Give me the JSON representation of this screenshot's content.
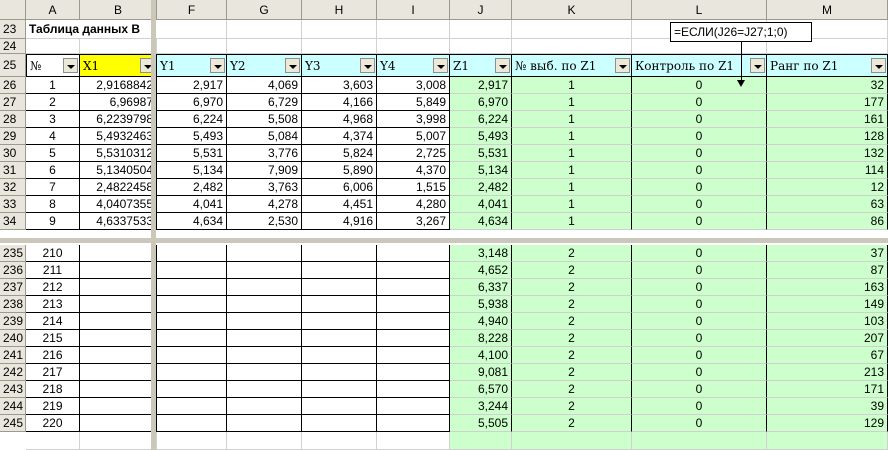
{
  "columns": [
    "A",
    "B",
    "F",
    "G",
    "H",
    "I",
    "J",
    "K",
    "L",
    "M"
  ],
  "rows_top": [
    "23",
    "24",
    "25",
    "26",
    "27",
    "28",
    "29",
    "30",
    "31",
    "32",
    "33",
    "34"
  ],
  "rows_bottom": [
    "235",
    "236",
    "237",
    "238",
    "239",
    "240",
    "241",
    "242",
    "243",
    "244",
    "245"
  ],
  "title": "Таблица данных В",
  "headers": {
    "num": "№",
    "x1": "X1",
    "y1": "Y1",
    "y2": "Y2",
    "y3": "Y3",
    "y4": "Y4",
    "z1": "Z1",
    "sample": "№ выб. по Z1",
    "control": "Контроль по Z1",
    "rank": "Ранг по Z1"
  },
  "formula_callout": "=ЕСЛИ(J26=J27;1;0)",
  "top_data": [
    [
      "1",
      "2,9168842",
      "2,917",
      "4,069",
      "3,603",
      "3,008",
      "2,917",
      "1",
      "0",
      "32"
    ],
    [
      "2",
      "6,96987",
      "6,970",
      "6,729",
      "4,166",
      "5,849",
      "6,970",
      "1",
      "0",
      "177"
    ],
    [
      "3",
      "6,2239798",
      "6,224",
      "5,508",
      "4,968",
      "3,998",
      "6,224",
      "1",
      "0",
      "161"
    ],
    [
      "4",
      "5,4932463",
      "5,493",
      "5,084",
      "4,374",
      "5,007",
      "5,493",
      "1",
      "0",
      "128"
    ],
    [
      "5",
      "5,5310312",
      "5,531",
      "3,776",
      "5,824",
      "2,725",
      "5,531",
      "1",
      "0",
      "132"
    ],
    [
      "6",
      "5,1340504",
      "5,134",
      "7,909",
      "5,890",
      "4,370",
      "5,134",
      "1",
      "0",
      "114"
    ],
    [
      "7",
      "2,4822458",
      "2,482",
      "3,763",
      "6,006",
      "1,515",
      "2,482",
      "1",
      "0",
      "12"
    ],
    [
      "8",
      "4,0407355",
      "4,041",
      "4,278",
      "4,451",
      "4,280",
      "4,041",
      "1",
      "0",
      "63"
    ],
    [
      "9",
      "4,6337533",
      "4,634",
      "2,530",
      "4,916",
      "3,267",
      "4,634",
      "1",
      "0",
      "86"
    ]
  ],
  "bottom_data": [
    [
      "210",
      "",
      "",
      "",
      "",
      "",
      "3,148",
      "2",
      "0",
      "37"
    ],
    [
      "211",
      "",
      "",
      "",
      "",
      "",
      "4,652",
      "2",
      "0",
      "87"
    ],
    [
      "212",
      "",
      "",
      "",
      "",
      "",
      "6,337",
      "2",
      "0",
      "163"
    ],
    [
      "213",
      "",
      "",
      "",
      "",
      "",
      "5,938",
      "2",
      "0",
      "149"
    ],
    [
      "214",
      "",
      "",
      "",
      "",
      "",
      "4,940",
      "2",
      "0",
      "103"
    ],
    [
      "215",
      "",
      "",
      "",
      "",
      "",
      "8,228",
      "2",
      "0",
      "207"
    ],
    [
      "216",
      "",
      "",
      "",
      "",
      "",
      "4,100",
      "2",
      "0",
      "67"
    ],
    [
      "217",
      "",
      "",
      "",
      "",
      "",
      "9,081",
      "2",
      "0",
      "213"
    ],
    [
      "218",
      "",
      "",
      "",
      "",
      "",
      "6,570",
      "2",
      "0",
      "171"
    ],
    [
      "219",
      "",
      "",
      "",
      "",
      "",
      "3,244",
      "2",
      "0",
      "39"
    ],
    [
      "220",
      "",
      "",
      "",
      "",
      "",
      "5,505",
      "2",
      "0",
      "129"
    ]
  ],
  "colors": {
    "green": "#ccffcc",
    "cyan": "#ccffff",
    "yellow": "#ffff00"
  }
}
